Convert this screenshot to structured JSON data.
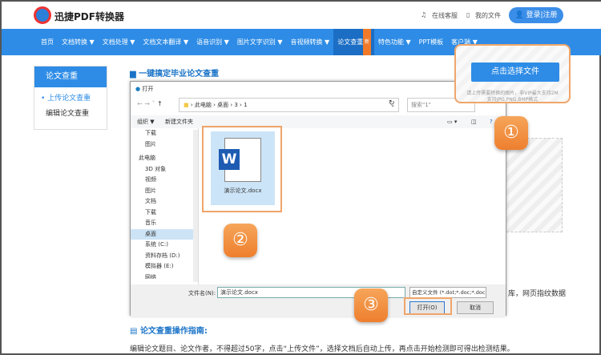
{
  "header": {
    "brand": "迅捷PDF转换器",
    "service": "在线客服",
    "files": "我的文件",
    "login": "登录|注册"
  },
  "nav": [
    "首页",
    "文档转换 ▼",
    "文档处理 ▼",
    "文档文本翻译 ▼",
    "语音识别 ▼",
    "图片文字识别 ▼",
    "音视频转换 ▼",
    "论文查重 ▼",
    "特色功能 ▼",
    "PPT模板",
    "客户端 ▼"
  ],
  "nav_badge": "新",
  "sidebar": {
    "title": "论文查重",
    "items": [
      "• 上传论文查重",
      "编辑论文查重"
    ]
  },
  "content": {
    "title": "一键搞定毕业论文查重",
    "partial_right": "库，网页指纹数据",
    "guide_title": "论文查重操作指南:",
    "guide_text": "编辑论文题目、论文作者，不得超过50字，点击“上传文件”，选择文档后自动上传，再点击开始检测即可得出检测结果。"
  },
  "upload": {
    "button": "点击选择文件",
    "hint1": "请上传需要转换的图片，非VIP最大支持2M",
    "hint2": "支持JPG,PNG,BMP格式"
  },
  "dialog": {
    "title": "打开",
    "path": "› 此电脑 › 桌面 › 3 › 1",
    "search_placeholder": "搜索\"1\"",
    "organize": "组织 ▼",
    "new_folder": "新建文件夹",
    "tree": [
      "下载",
      "图片",
      "此电脑",
      "3D 对象",
      "视频",
      "图片",
      "文档",
      "下载",
      "音乐",
      "桌面",
      "系统 (C:)",
      "资料存档 (D:)",
      "模拟器 (E:)",
      "网络"
    ],
    "file_name": "演示论文.docx",
    "filename_label": "文件名(N):",
    "filename_value": "演示论文.docx",
    "filter": "自定义文件 (*.dot;*.doc;*.doc",
    "open": "打开(O)",
    "cancel": "取消"
  },
  "steps": [
    "①",
    "②",
    "③"
  ]
}
